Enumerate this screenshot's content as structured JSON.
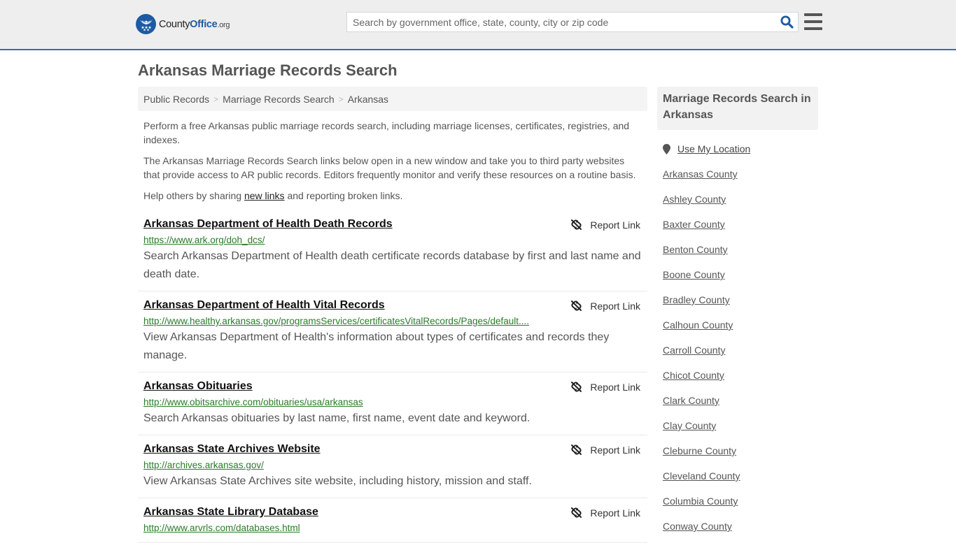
{
  "header": {
    "logo": {
      "name": "County",
      "highlight": "Office",
      "tld": ".org"
    },
    "search": {
      "placeholder": "Search by government office, state, county, city or zip code",
      "value": ""
    },
    "colors": {
      "brand": "#1d5aa3",
      "header_bg": "#eeeeee",
      "header_border": "#2b72b5"
    }
  },
  "page": {
    "title": "Arkansas Marriage Records Search"
  },
  "breadcrumb": [
    {
      "label": "Public Records"
    },
    {
      "label": "Marriage Records Search"
    },
    {
      "label": "Arkansas"
    }
  ],
  "breadcrumb_separator": ">",
  "intro": {
    "p1": "Perform a free Arkansas public marriage records search, including marriage licenses, certificates, registries, and indexes.",
    "p2": "The Arkansas Marriage Records Search links below open in a new window and take you to third party websites that provide access to AR public records. Editors frequently monitor and verify these resources on a routine basis.",
    "p3_before": "Help others by sharing ",
    "p3_link": "new links",
    "p3_after": " and reporting broken links."
  },
  "report_label": "Report Link",
  "results": [
    {
      "title": "Arkansas Department of Health Death Records",
      "url": "https://www.ark.org/doh_dcs/",
      "description": "Search Arkansas Department of Health death certificate records database by first and last name and death date."
    },
    {
      "title": "Arkansas Department of Health Vital Records",
      "url": "http://www.healthy.arkansas.gov/programsServices/certificatesVitalRecords/Pages/default....",
      "description": "View Arkansas Department of Health's information about types of certificates and records they manage."
    },
    {
      "title": "Arkansas Obituaries",
      "url": "http://www.obitsarchive.com/obituaries/usa/arkansas",
      "description": "Search Arkansas obituaries by last name, first name, event date and keyword."
    },
    {
      "title": "Arkansas State Archives Website",
      "url": "http://archives.arkansas.gov/",
      "description": "View Arkansas State Archives site website, including history, mission and staff."
    },
    {
      "title": "Arkansas State Library Database",
      "url": "http://www.arvrls.com/databases.html",
      "description": ""
    }
  ],
  "sidebar": {
    "heading": "Marriage Records Search in Arkansas",
    "use_location": "Use My Location",
    "counties": [
      "Arkansas County",
      "Ashley County",
      "Baxter County",
      "Benton County",
      "Boone County",
      "Bradley County",
      "Calhoun County",
      "Carroll County",
      "Chicot County",
      "Clark County",
      "Clay County",
      "Cleburne County",
      "Cleveland County",
      "Columbia County",
      "Conway County"
    ]
  }
}
